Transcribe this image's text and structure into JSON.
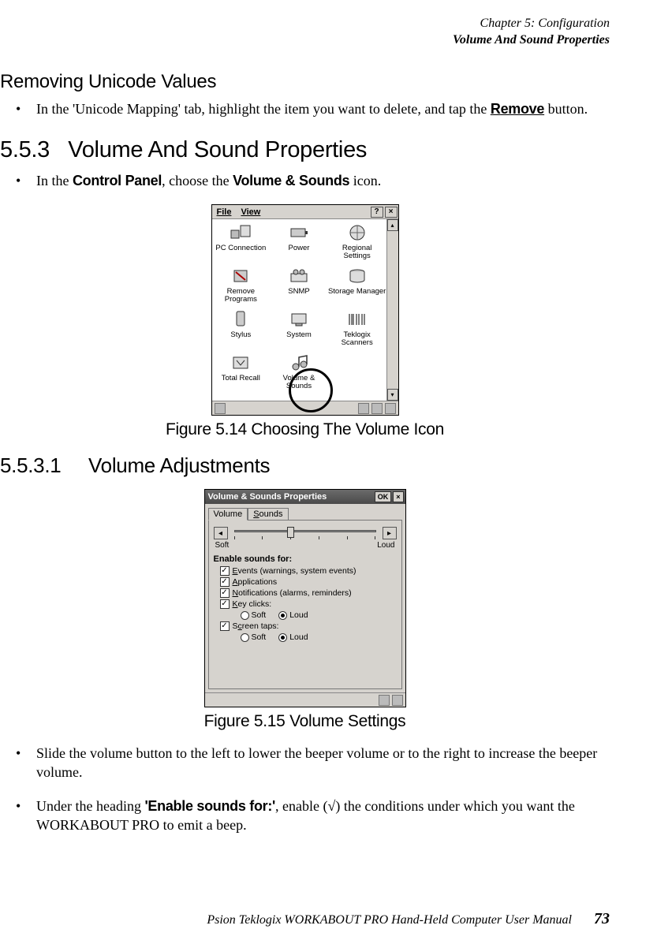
{
  "header": {
    "line1": "Chapter 5: Configuration",
    "line2": "Volume And Sound Properties"
  },
  "section_removing": {
    "title": "Removing Unicode Values",
    "bullet_pre": "In the 'Unicode Mapping' tab, highlight the item you want to delete, and tap the ",
    "bullet_button": "Remove",
    "bullet_post": " button."
  },
  "section_553": {
    "number": "5.5.3",
    "title": "Volume And Sound Properties",
    "bullet_pre": "In the ",
    "bullet_b1": "Control Panel",
    "bullet_mid": ", choose the ",
    "bullet_b2": "Volume & Sounds",
    "bullet_post": " icon."
  },
  "fig514": {
    "caption": "Figure 5.14 Choosing The Volume Icon",
    "menu_file": "File",
    "menu_view": "View",
    "help": "?",
    "close": "×",
    "items": [
      "PC Connection",
      "Power",
      "Regional Settings",
      "Remove Programs",
      "SNMP",
      "Storage Manager",
      "Stylus",
      "System",
      "Teklogix Scanners",
      "Total Recall",
      "Volume & Sounds",
      ""
    ]
  },
  "section_5531": {
    "number": "5.5.3.1",
    "title": "Volume Adjustments"
  },
  "fig515": {
    "caption": "Figure 5.15 Volume Settings",
    "title": "Volume & Sounds Properties",
    "ok": "OK",
    "close": "×",
    "tab_volume": "Volume",
    "tab_sounds": "Sounds",
    "label_soft": "Soft",
    "label_loud": "Loud",
    "heading": "Enable sounds for:",
    "chk_events": "Events (warnings, system events)",
    "chk_apps": "Applications",
    "chk_notif": "Notifications (alarms, reminders)",
    "chk_keyclicks": "Key clicks:",
    "chk_screentaps": "Screen taps:",
    "radio_soft": "Soft",
    "radio_loud": "Loud"
  },
  "bullets_bottom": {
    "b1": "Slide the volume button to the left to lower the beeper volume or to the right to increase the beeper volume.",
    "b2_pre": "Under the heading ",
    "b2_b": "'Enable sounds for:'",
    "b2_mid": ", enable (",
    "b2_check": "√",
    "b2_post": ") the conditions under which you want the WORKABOUT PRO to emit a beep."
  },
  "footer": {
    "text": "Psion Teklogix WORKABOUT PRO Hand-Held Computer User Manual",
    "page": "73"
  }
}
